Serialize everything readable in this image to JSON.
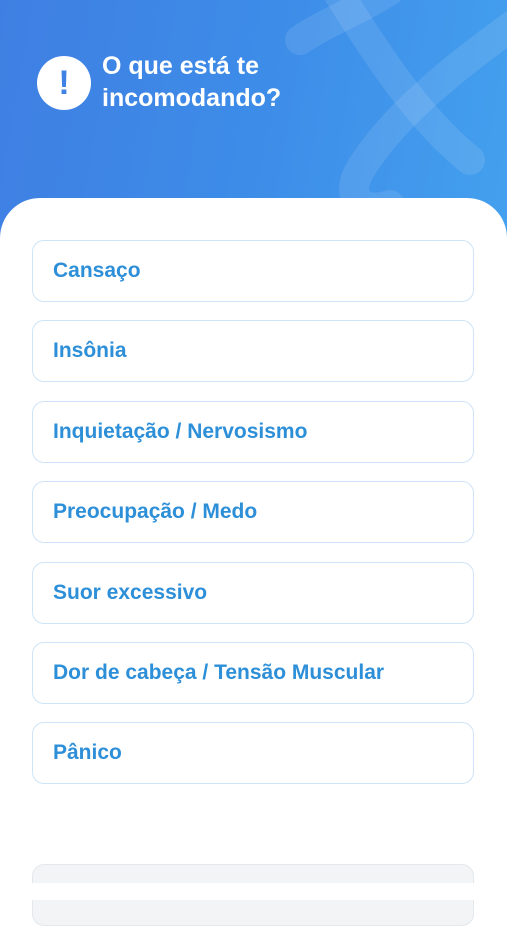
{
  "header": {
    "icon": "exclamation-icon",
    "icon_glyph": "!",
    "title_line1": "O que está te",
    "title_line2": "incomodando?",
    "gradient_start": "#3f7fe3",
    "gradient_end": "#44a0ee"
  },
  "options": [
    {
      "label": "Cansaço"
    },
    {
      "label": "Insônia"
    },
    {
      "label": "Inquietação / Nervosismo"
    },
    {
      "label": "Preocupação / Medo"
    },
    {
      "label": "Suor excessivo"
    },
    {
      "label": "Dor de cabeça / Tensão Muscular"
    },
    {
      "label": "Pânico"
    }
  ],
  "colors": {
    "option_text": "#2d8fd8",
    "option_border": "#cfe4f8"
  }
}
